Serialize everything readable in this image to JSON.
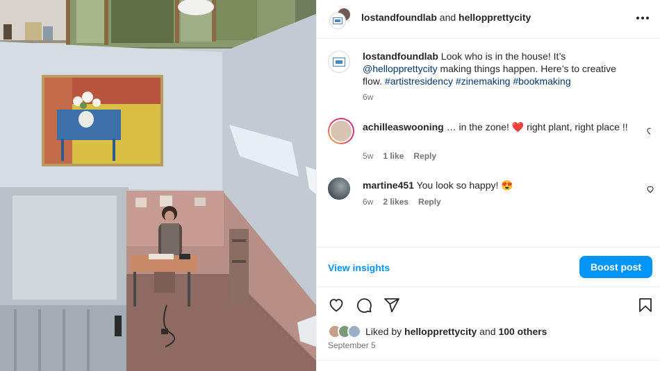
{
  "header": {
    "author": "lostandfoundlab",
    "and_text": "and",
    "collaborator": "hellopprettycity",
    "more_icon": "more-horizontal-icon"
  },
  "caption": {
    "username": "lostandfoundlab",
    "text_1": " Look who is in the house! It’s ",
    "mention": "@hellopprettycity",
    "text_2": " making things happen. Here’s to creative flow. ",
    "hashtags": [
      "#artistresidency",
      "#zinemaking",
      "#bookmaking"
    ],
    "time": "6w"
  },
  "comments": [
    {
      "username": "achilleaswooning",
      "text": " … in the zone! ",
      "emoji": "❤️",
      "text_after": " right plant, right place !!",
      "time": "5w",
      "likes": "1 like",
      "reply": "Reply"
    },
    {
      "username": "martine451",
      "text": " You look so happy! ",
      "emoji": "😍",
      "time": "6w",
      "likes": "2 likes",
      "reply": "Reply"
    }
  ],
  "insights": {
    "view_label": "View insights",
    "boost_label": "Boost post"
  },
  "actions": {
    "like_icon": "heart-icon",
    "comment_icon": "comment-icon",
    "share_icon": "send-icon",
    "save_icon": "bookmark-icon"
  },
  "likes": {
    "prefix": "Liked by ",
    "user": "hellopprettycity",
    "middle": " and ",
    "others": "100 others"
  },
  "post_date": "September 5",
  "colors": {
    "accent": "#0095f6",
    "link": "#00376b",
    "muted": "#737373",
    "text": "#262626"
  }
}
